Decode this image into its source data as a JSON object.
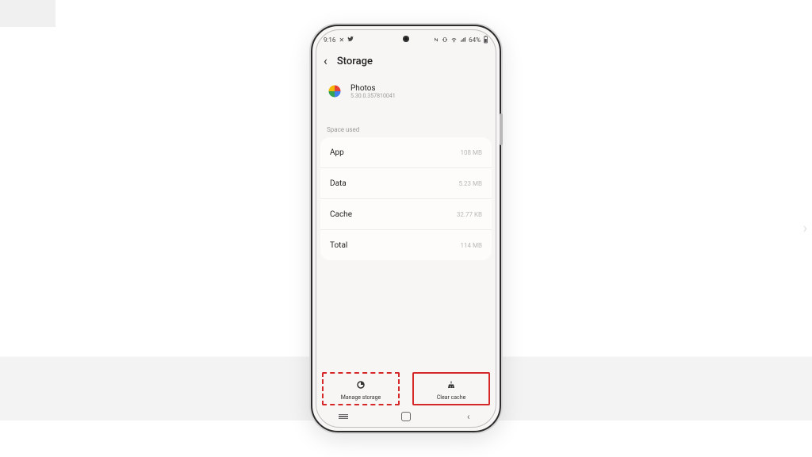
{
  "statusbar": {
    "time": "9:16",
    "battery": "64%"
  },
  "header": {
    "title": "Storage"
  },
  "app": {
    "name": "Photos",
    "version": "5.30.0.357810041"
  },
  "section": {
    "label": "Space used"
  },
  "rows": [
    {
      "label": "App",
      "value": "108 MB"
    },
    {
      "label": "Data",
      "value": "5.23 MB"
    },
    {
      "label": "Cache",
      "value": "32.77 KB"
    },
    {
      "label": "Total",
      "value": "114 MB"
    }
  ],
  "actions": {
    "manage": "Manage storage",
    "clear": "Clear cache"
  }
}
